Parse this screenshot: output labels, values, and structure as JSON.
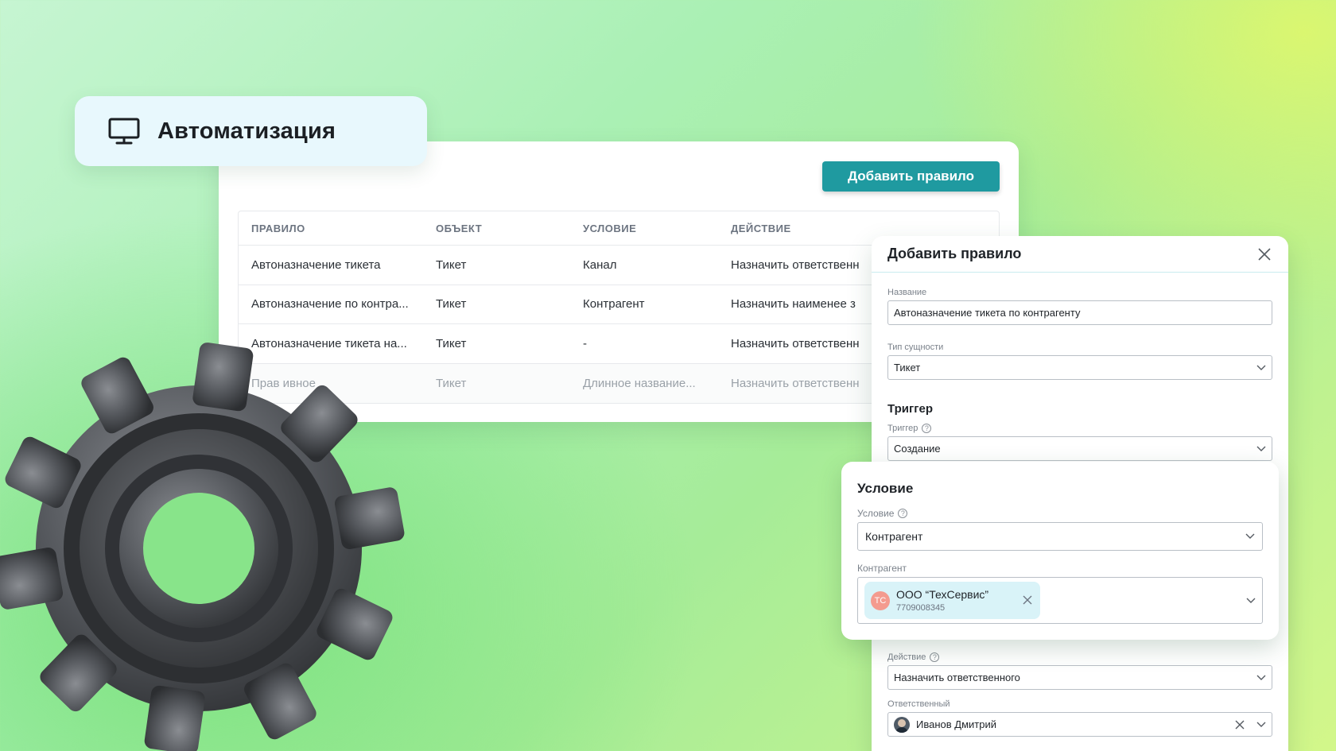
{
  "header": {
    "title": "Автоматизация",
    "icon": "monitor-icon"
  },
  "rules_panel": {
    "add_button_label": "Добавить правило",
    "columns": [
      "ПРАВИЛО",
      "ОБЪЕКТ",
      "УСЛОВИЕ",
      "ДЕЙСТВИЕ"
    ],
    "rows": [
      [
        "Автоназначение тикета",
        "Тикет",
        "Канал",
        "Назначить ответственн"
      ],
      [
        "Автоназначение по контра...",
        "Тикет",
        "Контрагент",
        "Назначить наименее з"
      ],
      [
        "Автоназначение тикета на...",
        "Тикет",
        "-",
        "Назначить ответственн"
      ],
      [
        "Прав           ивное",
        "Тикет",
        "Длинное название...",
        "Назначить ответственн"
      ]
    ]
  },
  "modal": {
    "title": "Добавить правило",
    "name_label": "Название",
    "name_value": "Автоназначение тикета по контрагенту",
    "entity_label": "Тип сущности",
    "entity_value": "Тикет",
    "trigger_section": "Триггер",
    "trigger_label": "Триггер",
    "trigger_value": "Создание",
    "action_label": "Действие",
    "action_value": "Назначить ответственного",
    "assignee_label": "Ответственный",
    "assignee_value": "Иванов Дмитрий"
  },
  "condition": {
    "section": "Условие",
    "condition_label": "Условие",
    "condition_value": "Контрагент",
    "counterparty_label": "Контрагент",
    "chip_initials": "ТС",
    "chip_name": "ООО “ТехСервис”",
    "chip_inn": "7709008345"
  },
  "colors": {
    "accent": "#1f9aa0",
    "chip_bg": "#d9f3f8",
    "avatar_tc": "#f49b8f"
  }
}
